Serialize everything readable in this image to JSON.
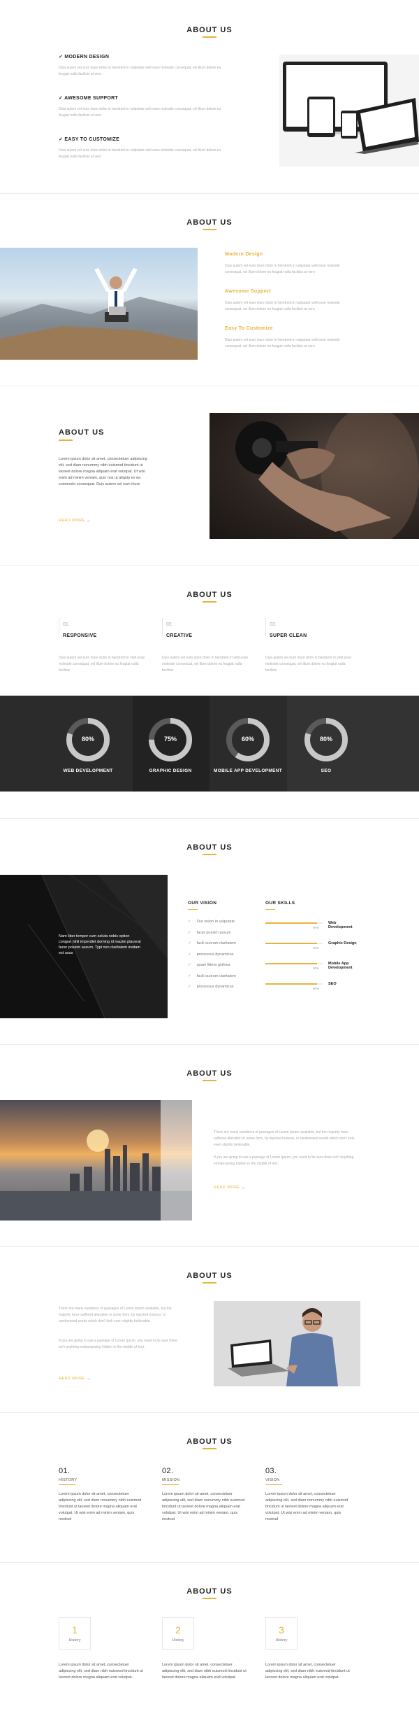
{
  "s1": {
    "title": "ABOUT US",
    "items": [
      {
        "label": "MODERN DESIGN",
        "text": "Duis autem vel eum iriure dolor in hendrerit in vulputate velit esse molestie consequat, vel illum dolore eu feugiat nulla facilisis at vero"
      },
      {
        "label": "AWESOME SUPPORT",
        "text": "Duis autem vel eum iriure dolor in hendrerit in vulputate velit esse molestie consequat, vel illum dolore eu feugiat nulla facilisis at vero"
      },
      {
        "label": "EASY TO CUSTOMIZE",
        "text": "Duis autem vel eum iriure dolor in hendrerit in vulputate velit esse molestie consequat, vel illum dolore eu feugiat nulla facilisis at vero"
      }
    ]
  },
  "s2": {
    "title": "ABOUT US",
    "items": [
      {
        "label": "Modern Design",
        "text": "Duis autem vel eum iriure dolor in hendrerit in vulputate velit esse molestie consequat, vel illum dolore eu feugiat nulla facilisis at vero"
      },
      {
        "label": "Awesome Support",
        "text": "Duis autem vel eum iriure dolor in hendrerit in vulputate velit esse molestie consequat, vel illum dolore eu feugiat nulla facilisis at vero"
      },
      {
        "label": "Easy To Customize",
        "text": "Duis autem vel eum iriure dolor in hendrerit in vulputate velit esse molestie consequat, vel illum dolore eu feugiat nulla facilisis at vero"
      }
    ]
  },
  "s3": {
    "title": "ABOUT US",
    "text": "Lorem ipsum dolor sit amet, consectetuer adipiscing elit, sed diam nonummy nibh euismod tincidunt ut laoreet dolore magna aliquam erat volutpat. Ut wisi enim ad minim veniam, quis nos ut aliquip ex ea commodo consequat. Duis autem vel eum iriure",
    "link": "READ MORE"
  },
  "s4": {
    "title": "ABOUT US",
    "cols": [
      {
        "num": "01.",
        "label": "RESPONSIVE",
        "text": "Duis autem vel eum iriure dolor in hendrerit in velit esse molestie consequat, vel illum dolore eu feugiat nulla facilisis"
      },
      {
        "num": "02.",
        "label": "CREATIVE",
        "text": "Duis autem vel eum iriure dolor in hendrerit in velit esse molestie consequat, vel illum dolore eu feugiat nulla facilisis"
      },
      {
        "num": "03.",
        "label": "SUPER CLEAN",
        "text": "Duis autem vel eum iriure dolor in hendrerit in velit esse molestie consequat, vel illum dolore eu feugiat nulla facilisis"
      }
    ],
    "stats": [
      {
        "value": "80%",
        "pct": 80,
        "label": "WEB DEVELOPMENT"
      },
      {
        "value": "75%",
        "pct": 75,
        "label": "GRAPHIC DESIGN"
      },
      {
        "value": "60%",
        "pct": 60,
        "label": "MOBILE APP DEVELOPMENT"
      },
      {
        "value": "80%",
        "pct": 80,
        "label": "SEO"
      }
    ]
  },
  "s5": {
    "title": "ABOUT US",
    "overlay": "Nam liber tempor cum soluta nobis option congue nihil imperdiet doming id mazim placerat facer possim assum. Typi non claritatem insitam est usus",
    "vision_title": "OUR VISION",
    "vision": [
      "Our vision in vulputate",
      "facer possim assum",
      "facili suorum claritatem",
      "processus dynamicus",
      "quam littera gothica",
      "facili suorum claritatem",
      "processus dynamicus"
    ],
    "skills_title": "OUR SKILLS",
    "skills": [
      {
        "label": "Web Development",
        "value": "90%",
        "pct": 90
      },
      {
        "label": "Graphic Design",
        "value": "90%",
        "pct": 90
      },
      {
        "label": "Mobile App Development",
        "value": "90%",
        "pct": 90
      },
      {
        "label": "SEO",
        "value": "90%",
        "pct": 90
      }
    ]
  },
  "s6": {
    "title": "ABOUT US",
    "p1": "There are many variations of passages of Lorem Ipsum available, but the majority have suffered alteration in some form, by injected humour, or randomised words which don't look even slightly believable.",
    "p2": "If you are going to use a passage of Lorem Ipsum, you need to be sure there isn't anything embarrassing hidden in the middle of text.",
    "link": "READ MORE"
  },
  "s7": {
    "title": "ABOUT US",
    "p1": "There are many variations of passages of Lorem Ipsum available, but the majority have suffered alteration in some form, by injected humour, or randomised words which don't look even slightly believable.",
    "p2": "If you are going to use a passage of Lorem Ipsum, you need to be sure there isn't anything embarrassing hidden in the middle of text.",
    "link": "READ MORE"
  },
  "s8": {
    "title": "ABOUT US",
    "cols": [
      {
        "num": "01.",
        "label": "HISTORY",
        "text": "Lorem ipsum dolor sit amet, consectetuer adipiscing elit, sed diam nonummy nibh euismod tincidunt ut laoreet dolore magna aliquam erat volutpat. Ut wisi enim ad minim veniam, quis nostrud"
      },
      {
        "num": "02.",
        "label": "MISSION",
        "text": "Lorem ipsum dolor sit amet, consectetuer adipiscing elit, sed diam nonummy nibh euismod tincidunt ut laoreet dolore magna aliquam erat volutpat. Ut wisi enim ad minim veniam, quis nostrud"
      },
      {
        "num": "03.",
        "label": "VISION",
        "text": "Lorem ipsum dolor sit amet, consectetuer adipiscing elit, sed diam nonummy nibh euismod tincidunt ut laoreet dolore magna aliquam erat volutpat. Ut wisi enim ad minim veniam, quis nostrud"
      }
    ]
  },
  "s9": {
    "title": "ABOUT US",
    "cols": [
      {
        "num": "1",
        "label": "History",
        "text": "Lorem ipsum dolor sit amet, consectetuer adipiscing elit, sed diam nibh euismod tincidunt ut laoreet dolore magna aliquam erat volutpat."
      },
      {
        "num": "2",
        "label": "History",
        "text": "Lorem ipsum dolor sit amet, consectetuer adipiscing elit, sed diam nibh euismod tincidunt ut laoreet dolore magna aliquam erat volutpat."
      },
      {
        "num": "3",
        "label": "History",
        "text": "Lorem ipsum dolor sit amet, consectetuer adipiscing elit, sed diam nibh euismod tincidunt ut laoreet dolore magna aliquam erat volutpat."
      }
    ]
  },
  "colors": {
    "accent": "#e8b33b",
    "dark": "#2b2b2b",
    "text": "#222222",
    "muted": "#aaaaaa"
  },
  "icons": [
    "check-icon",
    "arrow-right-icon",
    "devices-illustration",
    "businessman-photo",
    "dumbbell-photo",
    "building-photo",
    "city-photo",
    "man-with-laptop-photo"
  ]
}
